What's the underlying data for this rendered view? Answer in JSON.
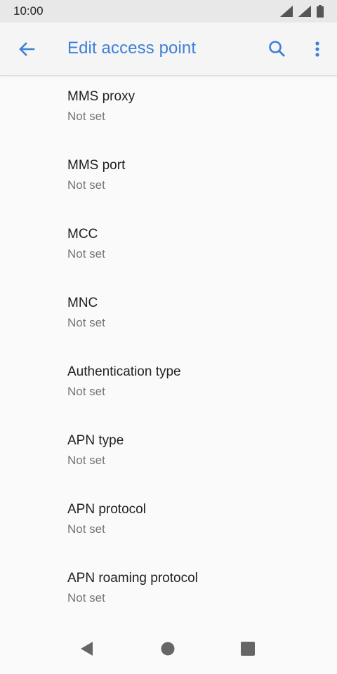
{
  "status_bar": {
    "time": "10:00",
    "icons": [
      "signal-icon",
      "signal-icon",
      "battery-icon"
    ]
  },
  "app_bar": {
    "title": "Edit access point",
    "back_icon": "arrow-back-icon",
    "search_icon": "search-icon",
    "more_icon": "more-vert-icon",
    "accent_color": "#3f7fd8"
  },
  "settings": [
    {
      "label": "MMS proxy",
      "value": "Not set"
    },
    {
      "label": "MMS port",
      "value": "Not set"
    },
    {
      "label": "MCC",
      "value": "Not set"
    },
    {
      "label": "MNC",
      "value": "Not set"
    },
    {
      "label": "Authentication type",
      "value": "Not set"
    },
    {
      "label": "APN type",
      "value": "Not set"
    },
    {
      "label": "APN protocol",
      "value": "Not set"
    },
    {
      "label": "APN roaming protocol",
      "value": "Not set"
    }
  ],
  "nav_bar": {
    "icons": [
      "back-triangle-icon",
      "home-circle-icon",
      "recents-square-icon"
    ]
  }
}
